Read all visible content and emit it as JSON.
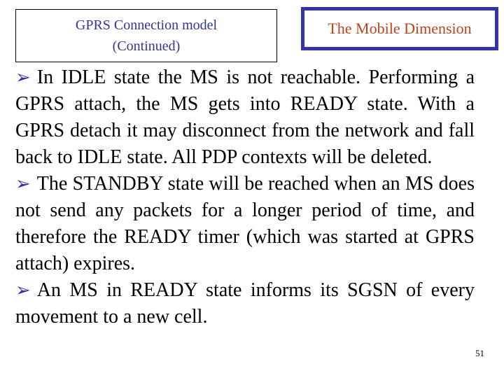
{
  "slide": {
    "background_color": "#ffffff",
    "page_number": "51"
  },
  "topic_box": {
    "border_color": "#000000",
    "text_color": "#333399",
    "line1": "GPRS Connection model",
    "line2": "(Continued)"
  },
  "section_box": {
    "border_color": "#3333aa",
    "text_color": "#b8431e",
    "title": "The Mobile Dimension"
  },
  "body": {
    "text_color": "#000000",
    "bullet_glyph": "➢",
    "bullet_color": "#3333aa",
    "paragraphs": [
      {
        "bullet": "➢",
        "text": "In IDLE state the MS is not reachable. Performing a GPRS attach, the MS gets into READY state. With a GPRS detach it may disconnect from the network and fall back to IDLE state. All PDP contexts will be deleted."
      },
      {
        "bullet": "➢",
        "text": "The STANDBY state will be reached when an MS does not send any packets for a longer period of time, and therefore the READY timer (which was started at GPRS attach) expires."
      },
      {
        "bullet": "➢",
        "text": "An MS in READY state informs its SGSN of every movement to a new cell."
      }
    ]
  }
}
